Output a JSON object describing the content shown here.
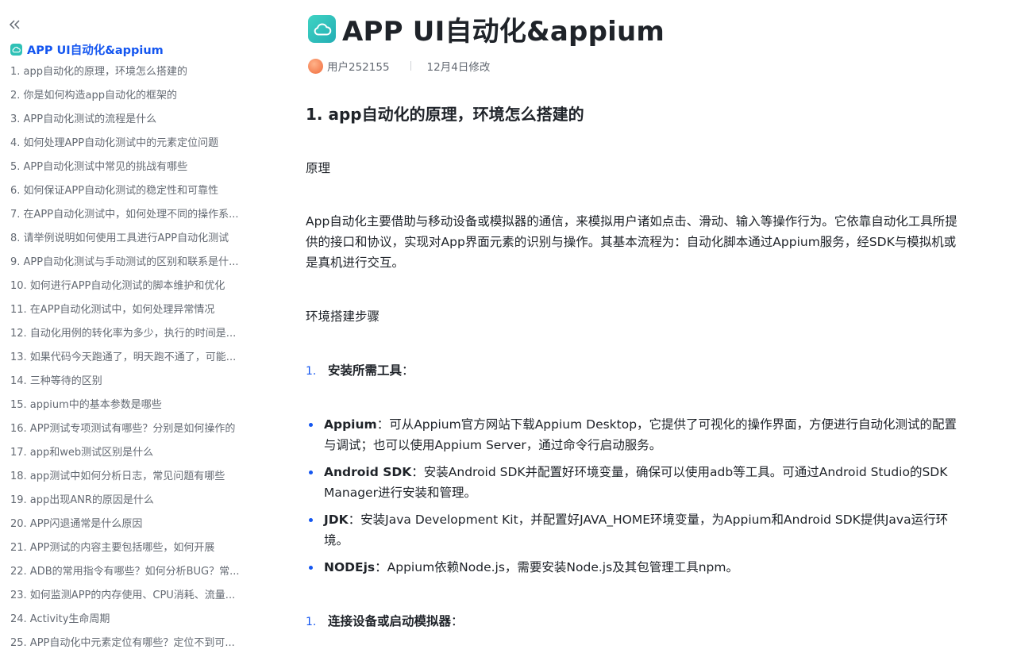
{
  "sidebar": {
    "collapse_icon": "double-chevron-left-icon",
    "title": "APP UI自动化&appium",
    "items": [
      "1. app自动化的原理，环境怎么搭建的",
      "2. 你是如何构造app自动化的框架的",
      "3. APP自动化测试的流程是什么",
      "4. 如何处理APP自动化测试中的元素定位问题",
      "5. APP自动化测试中常见的挑战有哪些",
      "6. 如何保证APP自动化测试的稳定性和可靠性",
      "7. 在APP自动化测试中，如何处理不同的操作系...",
      "8. 请举例说明如何使用工具进行APP自动化测试",
      "9. APP自动化测试与手动测试的区别和联系是什...",
      "10. 如何进行APP自动化测试的脚本维护和优化",
      "11. 在APP自动化测试中，如何处理异常情况",
      "12. 自动化用例的转化率为多少，执行的时间是...",
      "13. 如果代码今天跑通了，明天跑不通了，可能...",
      "14. 三种等待的区别",
      "15. appium中的基本参数是哪些",
      "16. APP测试专项测试有哪些？分别是如何操作的",
      "17. app和web测试区别是什么",
      "18. app测试中如何分析日志，常见问题有哪些",
      "19. app出现ANR的原因是什么",
      "20. APP闪退通常是什么原因",
      "21. APP测试的内容主要包括哪些，如何开展",
      "22. ADB的常用指令有哪些？如何分析BUG？常...",
      "23. 如何监测APP的内存使用、CPU消耗、流量...",
      "24. Activity生命周期",
      "25. APP自动化中元素定位有哪些？定位不到可..."
    ]
  },
  "doc": {
    "title": "APP UI自动化&appium",
    "author": "用户252155",
    "modified": "12月4日修改",
    "heading": "1. app自动化的原理，环境怎么搭建的",
    "p_principle": "原理",
    "p_body": "App自动化主要借助与移动设备或模拟器的通信，来模拟用户诸如点击、滑动、输入等操作行为。它依靠自动化工具所提供的接口和协议，实现对App界面元素的识别与操作。其基本流程为：自动化脚本通过Appium服务，经SDK与模拟机或是真机进行交互。",
    "p_env": "环境搭建步骤",
    "step1_num": "1.",
    "step1_text": "安装所需工具",
    "step2_num": "1.",
    "step2_text": "连接设备或启动模拟器",
    "colon": "：",
    "bullets": [
      {
        "term": "Appium",
        "text": "：可从Appium官方网站下载Appium Desktop，它提供了可视化的操作界面，方便进行自动化测试的配置与调试；也可以使用Appium Server，通过命令行启动服务。"
      },
      {
        "term": "Android SDK",
        "text": "：安装Android SDK并配置好环境变量，确保可以使用adb等工具。可通过Android Studio的SDK Manager进行安装和管理。"
      },
      {
        "term": "JDK",
        "text": "：安装Java Development Kit，并配置好JAVA_HOME环境变量，为Appium和Android SDK提供Java运行环境。"
      },
      {
        "term": "NODEjs",
        "text": "：Appium依赖Node.js，需要安装Node.js及其包管理工具npm。"
      }
    ]
  },
  "colors": {
    "accent": "#1456f0",
    "doc_icon": "#2fc1b6",
    "text": "#1f2329",
    "muted": "#646a73"
  }
}
